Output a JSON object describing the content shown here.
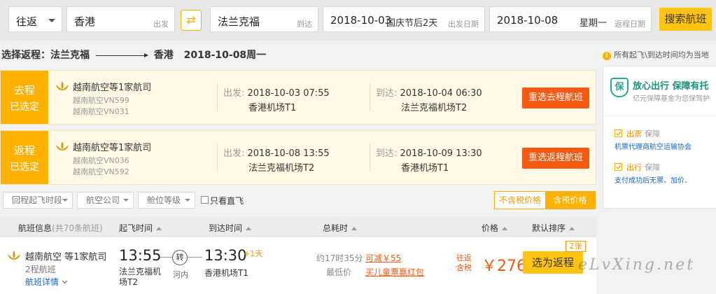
{
  "search": {
    "trip_type": "往返",
    "from_city": "香港",
    "from_hint": "出发",
    "to_city": "法兰克福",
    "to_hint": "到达",
    "depart_date": "2018-10-03",
    "depart_extra": "国庆节后2天",
    "depart_hint": "出发日期",
    "return_date": "2018-10-08",
    "return_extra": "星期一",
    "return_hint": "返程日期",
    "search_button": "搜索航班",
    "swap_icon": "⇄"
  },
  "route": {
    "prefix": "选择返程：法兰克福",
    "dest": "香港",
    "date": "2018-10-08周一"
  },
  "selected": [
    {
      "tag1": "去程",
      "tag2": "已选定",
      "airline": "越南航空等1家航司",
      "flight1": "越南航空VN599",
      "flight2": "越南航空VN031",
      "dep_label": "出发: ",
      "dep_dt": "2018-10-03 07:55",
      "dep_airport": "香港机场T1",
      "arr_label": "到达: ",
      "arr_dt": "2018-10-04 06:30",
      "arr_airport": "法兰克福机场T2",
      "button": "重选去程航班"
    },
    {
      "tag1": "返程",
      "tag2": "已选定",
      "airline": "越南航空等1家航司",
      "flight1": "越南航空VN036",
      "flight2": "越南航空VN592",
      "dep_label": "出发: ",
      "dep_dt": "2018-10-08 13:55",
      "dep_airport": "法兰克福机场T2",
      "arr_label": "到达: ",
      "arr_dt": "2018-10-09 13:30",
      "arr_airport": "香港机场T1",
      "button": "重选返程航班"
    }
  ],
  "filters": {
    "items": [
      "回程起飞时段",
      "航空公司",
      "舱位等级"
    ],
    "direct_only": "只看直飞",
    "tax_excluded": "不含税价格",
    "tax_included": "含税价格"
  },
  "table": {
    "headers": {
      "info": "航班信息",
      "info_sub": "(共70条航班)",
      "depart": "起飞时间",
      "arrive": "到达时间",
      "duration": "总耗时",
      "price": "价格",
      "sort": "默认排序"
    }
  },
  "flight": {
    "airline": "越南航空 等1家航司",
    "stops": "2程航班",
    "detail": "航班详情",
    "dep_time": "13:55",
    "dep_airport": "法兰克福机场T2",
    "connect": "转",
    "via": "河内",
    "arr_time": "13:30",
    "next_day": "+1天",
    "arr_airport": "香港机场T1",
    "duration": "约17时35分",
    "lowest": "最低价",
    "promo1": "可减￥55",
    "promo2": "买儿童票赢红包",
    "price_tag1": "往返",
    "price_tag2": "含税",
    "price": "￥2765",
    "badge": "2张",
    "select_button": "选为返程"
  },
  "sidebar": {
    "note": "所有起飞\\到达时间均为当地",
    "card_title": "放心出行 保障有托",
    "card_sub": "亿元保障基金为您保驾护",
    "item1_title": "出票",
    "item1_small": "保障",
    "item1_desc": "机票代理商航空运输协会",
    "item2_title": "出行",
    "item2_small": "保障",
    "item2_desc": "支付成功后无票、加价、"
  },
  "watermark": "eLvXing.net",
  "colors": {
    "accent": "#ffb100",
    "button_orange": "#f45a12",
    "search_yellow": "#ffc312",
    "link_blue": "#1a66c2"
  }
}
